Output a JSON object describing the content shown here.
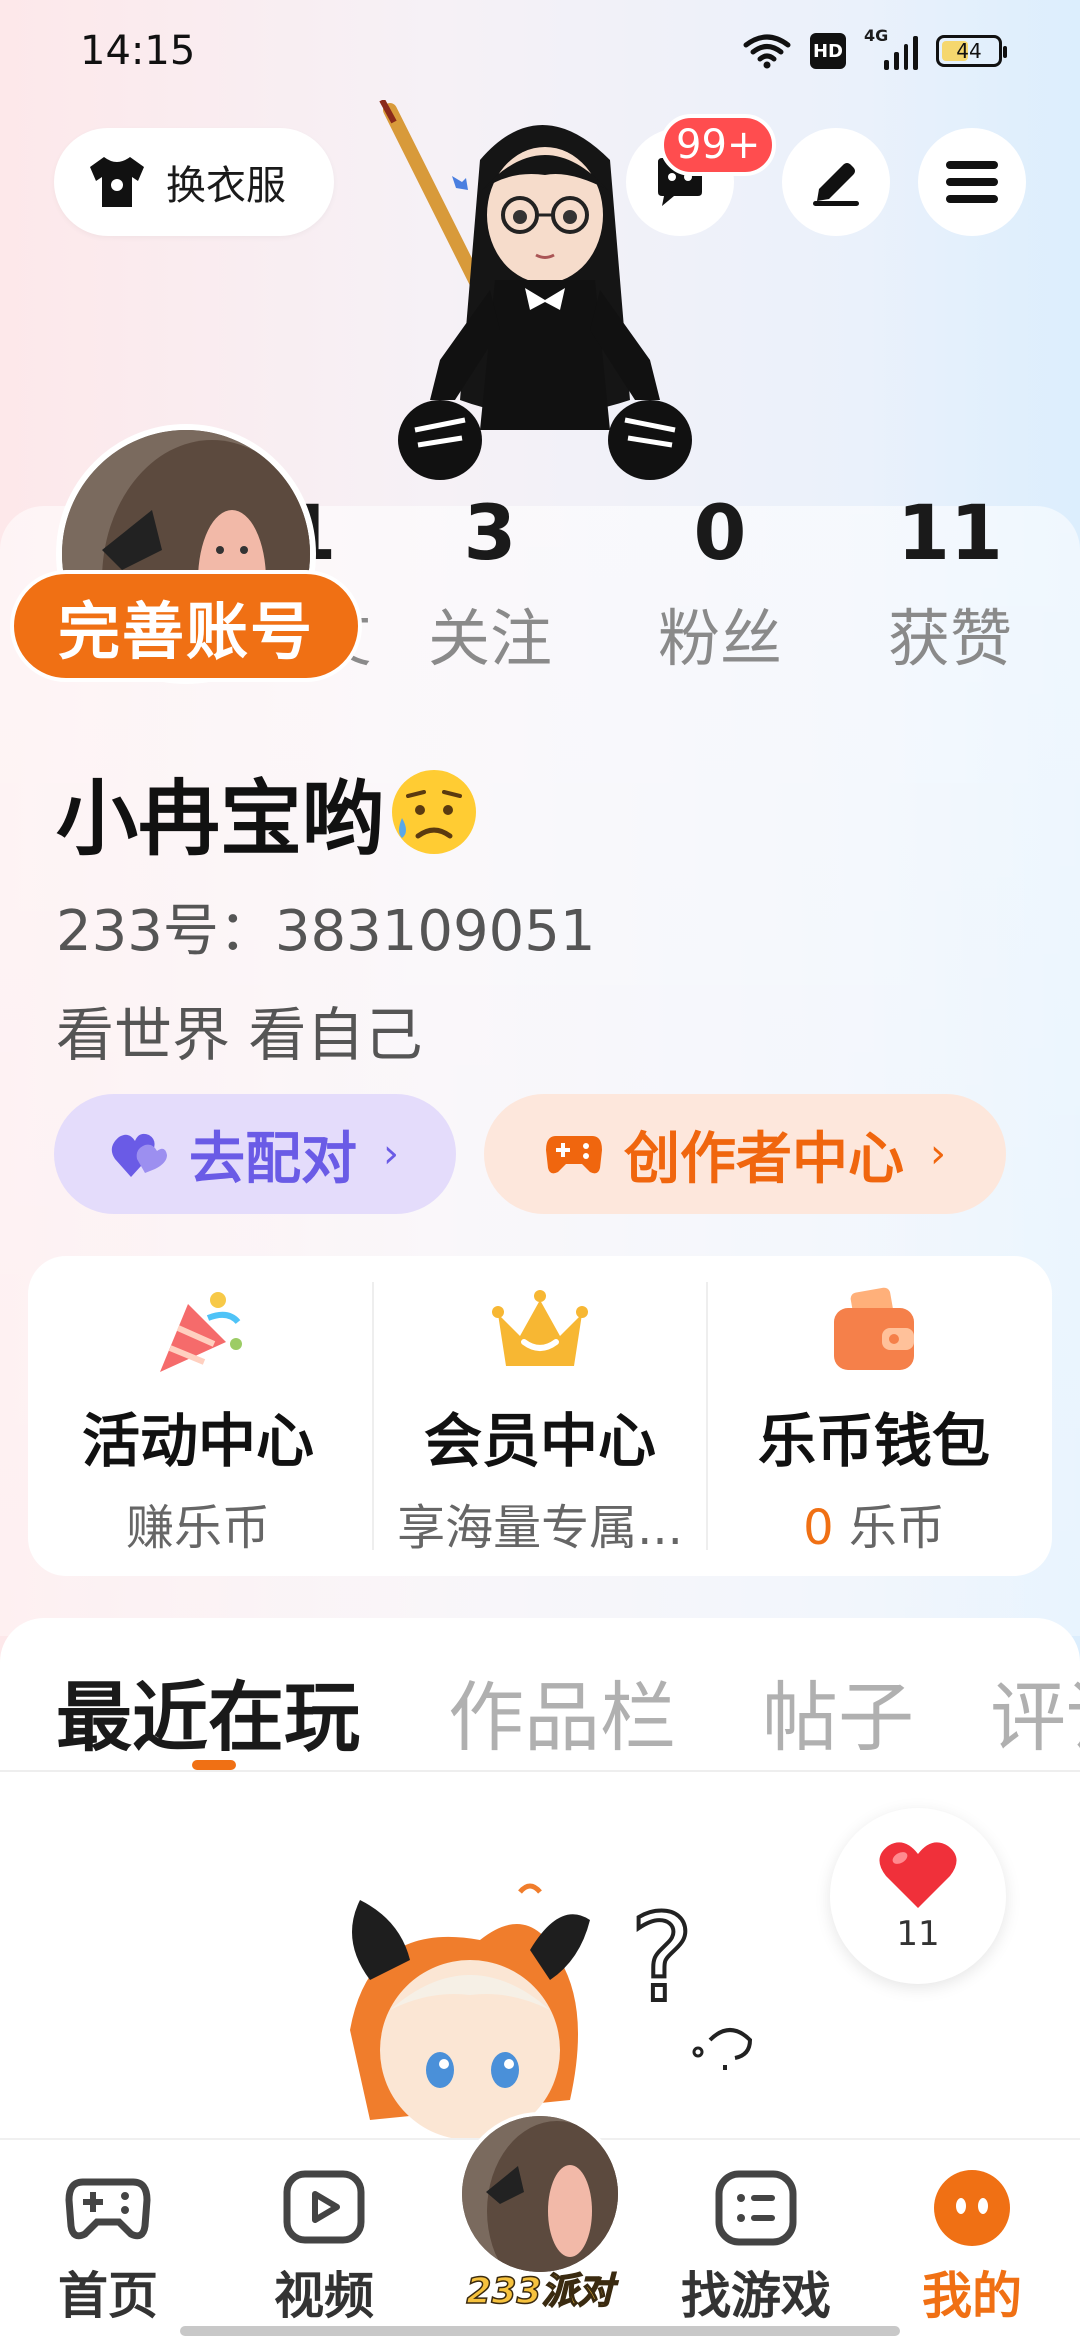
{
  "status_bar": {
    "time": "14:15",
    "hd": "HD",
    "network": "4G",
    "battery": "44"
  },
  "top_bar": {
    "dress_label": "换衣服",
    "message_badge": "99+"
  },
  "profile": {
    "complete_label": "完善账号",
    "stats": [
      {
        "num": "1",
        "label": "好友"
      },
      {
        "num": "3",
        "label": "关注"
      },
      {
        "num": "0",
        "label": "粉丝"
      },
      {
        "num": "11",
        "label": "获赞"
      }
    ],
    "nickname": "小冉宝哟",
    "id_line": "233号：383109051",
    "bio": "看世界 看自己",
    "match_label": "去配对",
    "creator_label": "创作者中心"
  },
  "features": [
    {
      "title": "活动中心",
      "sub": "赚乐币",
      "icon": "party-popper-icon"
    },
    {
      "title": "会员中心",
      "sub": "享海量专属...",
      "icon": "crown-icon"
    },
    {
      "title": "乐币钱包",
      "sub_highlight": "0",
      "sub": " 乐币",
      "icon": "wallet-icon"
    }
  ],
  "tabs": [
    "最近在玩",
    "作品栏",
    "帖子",
    "评论"
  ],
  "like_count": "11",
  "bottom_nav": [
    {
      "label": "首页",
      "icon": "gamepad-icon"
    },
    {
      "label": "视频",
      "icon": "play-icon"
    },
    {
      "label": "233派对",
      "icon": "avatar"
    },
    {
      "label": "找游戏",
      "icon": "list-icon"
    },
    {
      "label": "我的",
      "icon": "face-icon"
    }
  ],
  "colors": {
    "accent": "#f07014",
    "match": "#6a5be6",
    "badge": "#ff4d4f"
  }
}
